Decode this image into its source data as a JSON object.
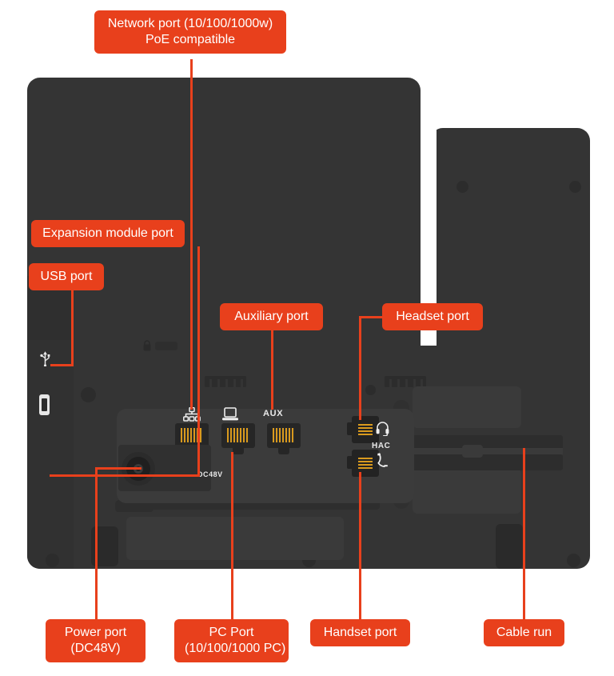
{
  "diagram": {
    "title": "IP phone rear panel port callout diagram",
    "accent_color": "#E8401C",
    "body_color": "#343434",
    "pin_color": "#D99A1E",
    "label_text_color": "#FFFFFF"
  },
  "callouts": [
    {
      "id": "network",
      "name": "network-port",
      "label": "Network port (10/100/1000w)\nPoE compatible"
    },
    {
      "id": "expansion",
      "name": "expansion-module-port",
      "label": "Expansion module port"
    },
    {
      "id": "usb",
      "name": "usb-port",
      "label": "USB port"
    },
    {
      "id": "auxiliary",
      "name": "auxiliary-port",
      "label": "Auxiliary port"
    },
    {
      "id": "headset",
      "name": "headset-port",
      "label": "Headset port"
    },
    {
      "id": "power",
      "name": "power-port",
      "label": "Power port\n(DC48V)"
    },
    {
      "id": "pc",
      "name": "pc-port",
      "label": "PC Port\n(10/100/1000 PC)"
    },
    {
      "id": "handset",
      "name": "handset-port",
      "label": "Handset port"
    },
    {
      "id": "cablerun",
      "name": "cable-run",
      "label": "Cable run"
    }
  ],
  "silkscreen": {
    "aux": "AUX",
    "hac": "HAC",
    "dc48v": "DC48V"
  },
  "port_icons": {
    "network": "network-tree-icon",
    "pc": "computer-monitor-icon",
    "aux": "aux-text-icon",
    "headset": "headset-icon",
    "handset": "handset-phone-icon",
    "usb": "usb-trident-icon",
    "lock": "kensington-lock-icon"
  }
}
